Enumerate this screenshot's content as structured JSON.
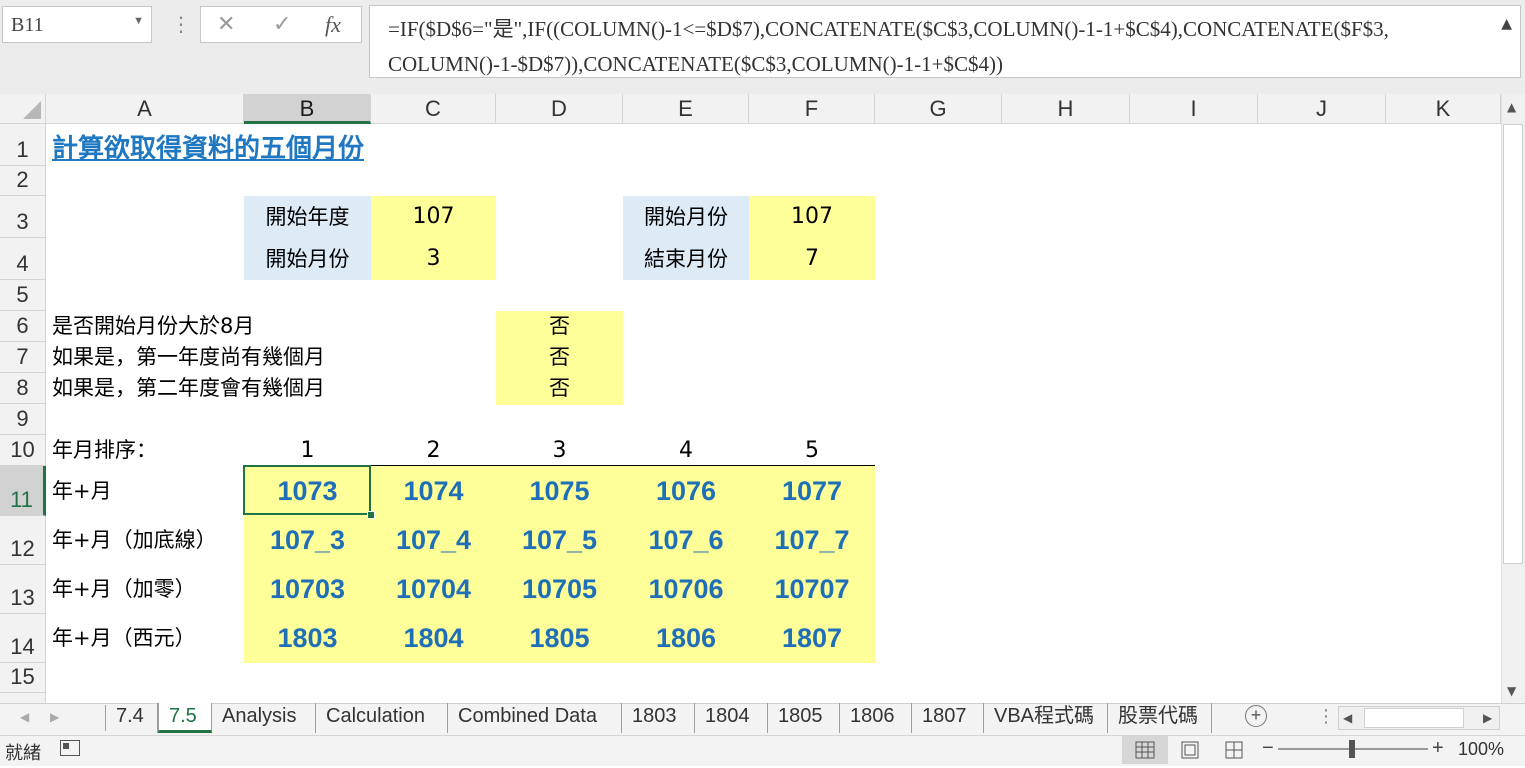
{
  "formula_bar": {
    "name_box": "B11",
    "cancel_icon": "✕",
    "enter_icon": "✓",
    "fx_label": "fx",
    "formula": "=IF($D$6=\"是\",IF((COLUMN()-1<=$D$7),CONCATENATE($C$3,COLUMN()-1-1+$C$4),CONCATENATE($F$3,\nCOLUMN()-1-$D$7)),CONCATENATE($C$3,COLUMN()-1-1+$C$4))"
  },
  "columns": [
    "A",
    "B",
    "C",
    "D",
    "E",
    "F",
    "G",
    "H",
    "I",
    "J",
    "K"
  ],
  "rows": [
    "1",
    "2",
    "3",
    "4",
    "5",
    "6",
    "7",
    "8",
    "9",
    "10",
    "11",
    "12",
    "13",
    "14",
    "15"
  ],
  "sheet": {
    "title": "計算欲取得資料的五個月份",
    "start_year_label": "開始年度",
    "start_year_value": "107",
    "start_month_label": "開始月份",
    "start_month_value": "3",
    "start_month2_label": "開始月份",
    "start_month2_value": "107",
    "end_month_label": "結束月份",
    "end_month_value": "7",
    "q1_label": "是否開始月份大於8月",
    "q1_value": "否",
    "q2_label": "如果是，第一年度尚有幾個月",
    "q2_value": "否",
    "q3_label": "如果是，第二年度會有幾個月",
    "q3_value": "否",
    "order_label": "年月排序：",
    "order": [
      "1",
      "2",
      "3",
      "4",
      "5"
    ],
    "row11_label": "年+月",
    "row11": [
      "1073",
      "1074",
      "1075",
      "1076",
      "1077"
    ],
    "row12_label": "年+月（加底線）",
    "row12": [
      "107_3",
      "107_4",
      "107_5",
      "107_6",
      "107_7"
    ],
    "row13_label": "年+月（加零）",
    "row13": [
      "10703",
      "10704",
      "10705",
      "10706",
      "10707"
    ],
    "row14_label": "年+月（西元）",
    "row14": [
      "1803",
      "1804",
      "1805",
      "1806",
      "1807"
    ]
  },
  "tabs": [
    "7.4",
    "7.5",
    "Analysis",
    "Calculation",
    "Combined Data",
    "1803",
    "1804",
    "1805",
    "1806",
    "1807",
    "VBA程式碼",
    "股票代碼"
  ],
  "active_tab": "7.5",
  "status": {
    "ready": "就緒",
    "zoom": "100%"
  },
  "colors": {
    "accent": "#217346",
    "title_blue": "#1f78c1",
    "yellow": "#ffff99",
    "light_blue": "#ddebf7"
  }
}
